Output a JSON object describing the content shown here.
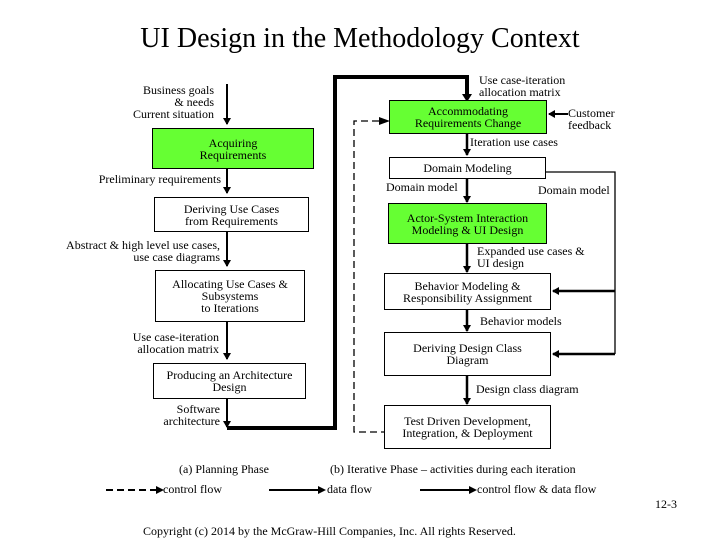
{
  "title": "UI Design in the Methodology Context",
  "planning_phase": {
    "inputs_label": "Business goals\n& needs\nCurrent situation",
    "boxes": [
      {
        "id": "acquiring-requirements",
        "label": "Acquiring\nRequirements",
        "highlight": true
      },
      {
        "id": "deriving-use-cases",
        "label": "Deriving Use Cases\nfrom Requirements",
        "highlight": false
      },
      {
        "id": "allocating-use-cases",
        "label": "Allocating Use Cases &\nSubsystems\nto Iterations",
        "highlight": false
      },
      {
        "id": "producing-architecture",
        "label": "Producing an Architecture\nDesign",
        "highlight": false
      }
    ],
    "flows": [
      "Preliminary requirements",
      "Abstract & high level use cases,\nuse case diagrams",
      "Use case-iteration\nallocation matrix",
      "Software\narchitecture"
    ],
    "caption": "(a) Planning Phase"
  },
  "iterative_phase": {
    "top_input": "Use case-iteration\nallocation matrix",
    "customer_feedback": "Customer\nfeedback",
    "boxes": [
      {
        "id": "accommodating-requirements-change",
        "label": "Accommodating\nRequirements Change",
        "highlight": true
      },
      {
        "id": "domain-modeling",
        "label": "Domain Modeling",
        "highlight": false
      },
      {
        "id": "actor-system-interaction",
        "label": "Actor-System Interaction\nModeling & UI Design",
        "highlight": true
      },
      {
        "id": "behavior-modeling",
        "label": "Behavior Modeling &\nResponsibility Assignment",
        "highlight": false
      },
      {
        "id": "deriving-design-class-diagram",
        "label": "Deriving Design Class\nDiagram",
        "highlight": false
      },
      {
        "id": "test-driven-development",
        "label": "Test Driven Development,\nIntegration, & Deployment",
        "highlight": false
      }
    ],
    "flows": {
      "iteration_use_cases": "Iteration use cases",
      "domain_model_left": "Domain model",
      "domain_model_right": "Domain model",
      "expanded_use_cases": "Expanded use cases &\nUI design",
      "behavior_models": "Behavior models",
      "design_class_diagram": "Design class diagram"
    },
    "caption": "(b) Iterative Phase – activities during each iteration"
  },
  "legend": {
    "control_flow": "control flow",
    "data_flow": "data flow",
    "control_and_data_flow": "control flow & data flow"
  },
  "colors": {
    "highlight": "#66ff33",
    "line": "#000000"
  },
  "page_number": "12-3",
  "copyright": "Copyright (c) 2014 by the McGraw-Hill Companies, Inc. All rights Reserved."
}
